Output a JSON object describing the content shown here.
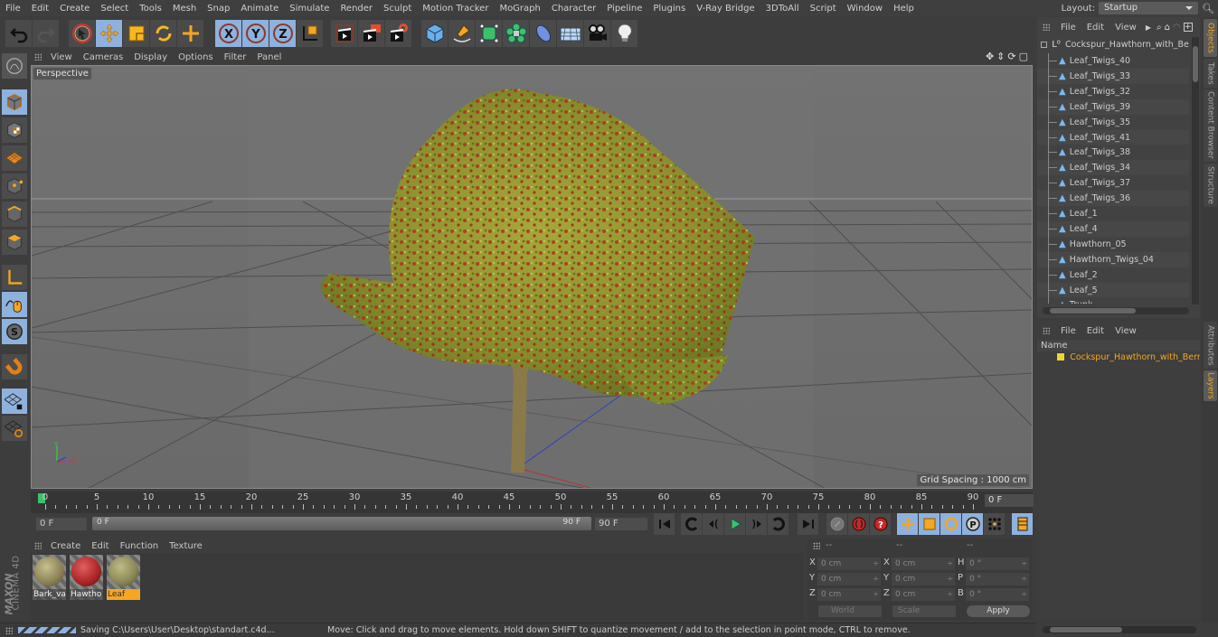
{
  "menubar": {
    "items": [
      "File",
      "Edit",
      "Create",
      "Select",
      "Tools",
      "Mesh",
      "Snap",
      "Animate",
      "Simulate",
      "Render",
      "Sculpt",
      "Motion Tracker",
      "MoGraph",
      "Character",
      "Pipeline",
      "Plugins",
      "V-Ray Bridge",
      "3DToAll",
      "Script",
      "Window",
      "Help"
    ],
    "layout_label": "Layout:",
    "layout_value": "Startup"
  },
  "toolbar": {
    "groups": [
      [
        "undo-icon",
        "redo-icon"
      ],
      [
        "live-selection-icon",
        "move-icon",
        "scale-icon",
        "rotate-icon",
        "recent-tool-icon"
      ],
      [
        "x-axis-lock-icon",
        "y-axis-lock-icon",
        "z-axis-lock-icon",
        "coordinate-system-icon"
      ],
      [
        "render-view-icon",
        "render-to-picture-viewer-icon",
        "render-settings-icon"
      ],
      [
        "cube-icon",
        "pen-spline-icon",
        "subdivision-surface-icon",
        "cloner-icon",
        "deformer-icon",
        "floor-icon",
        "camera-icon",
        "light-icon"
      ]
    ]
  },
  "left_tools": [
    "make-editable-icon",
    "model-mode-icon",
    "texture-mode-icon",
    "workplane-mode-icon",
    "points-mode-icon",
    "edges-mode-icon",
    "polygons-mode-icon",
    "axis-mode-icon",
    "tweak-mode-icon",
    "solo-icon",
    "snap-icon",
    "workplane-lock-icon",
    "workplane-align-icon"
  ],
  "viewport": {
    "menu": [
      "View",
      "Cameras",
      "Display",
      "Options",
      "Filter",
      "Panel"
    ],
    "label": "Perspective",
    "grid_spacing": "Grid Spacing : 1000 cm",
    "axis_labels": {
      "y": "Y",
      "z": "Z",
      "x": "X"
    }
  },
  "timeline": {
    "ticks": [
      "0",
      "5",
      "10",
      "15",
      "20",
      "25",
      "30",
      "35",
      "40",
      "45",
      "50",
      "55",
      "60",
      "65",
      "70",
      "75",
      "80",
      "85",
      "90"
    ],
    "current_frame": "0 F",
    "current_frame_field": "0 F"
  },
  "playback": {
    "start_field": "0 F",
    "range_start": "0 F",
    "range_end": "90 F",
    "end_field": "90 F",
    "buttons": [
      "go-to-start-icon",
      "previous-key-icon",
      "previous-frame-icon",
      "play-icon",
      "next-frame-icon",
      "next-key-icon",
      "go-to-end-icon"
    ],
    "record_buttons": [
      "motion-record-icon",
      "record-active-objects-icon",
      "autokeying-icon"
    ],
    "key_buttons": [
      "record-position-icon",
      "record-scale-icon",
      "record-rotation-icon",
      "record-parameter-icon",
      "record-point-level-icon"
    ],
    "timeline_button": "timeline-window-icon"
  },
  "materials": {
    "menu": [
      "Create",
      "Edit",
      "Function",
      "Texture"
    ],
    "items": [
      {
        "name": "Bark_var",
        "color": "#a39a6a",
        "selected": false
      },
      {
        "name": "Hawtho",
        "color": "#b0282a",
        "selected": false
      },
      {
        "name": "Leaf",
        "color": "#9a9560",
        "selected": true
      }
    ]
  },
  "brand": {
    "line1": "MAXON",
    "line2": "CINEMA 4D"
  },
  "coords": {
    "headers": [
      "--",
      "--",
      "--"
    ],
    "rows": [
      {
        "l1": "X",
        "v1": "0 cm",
        "l2": "X",
        "v2": "0 cm",
        "l3": "H",
        "v3": "0 °"
      },
      {
        "l1": "Y",
        "v1": "0 cm",
        "l2": "Y",
        "v2": "0 cm",
        "l3": "P",
        "v3": "0 °"
      },
      {
        "l1": "Z",
        "v1": "0 cm",
        "l2": "Z",
        "v2": "0 cm",
        "l3": "B",
        "v3": "0 °"
      }
    ],
    "mode_select": "World",
    "size_select": "Scale",
    "apply": "Apply"
  },
  "statusbar": {
    "progress": 1.0,
    "saving": "Saving C:\\Users\\User\\Desktop\\standart.c4d...",
    "hint": "Move: Click and drag to move elements. Hold down SHIFT to quantize movement / add to the selection in point mode, CTRL to remove."
  },
  "objects": {
    "menu": [
      "File",
      "Edit",
      "View"
    ],
    "root": "Cockspur_Hawthorn_with_Berries",
    "children": [
      "Leaf_Twigs_40",
      "Leaf_Twigs_33",
      "Leaf_Twigs_32",
      "Leaf_Twigs_39",
      "Leaf_Twigs_35",
      "Leaf_Twigs_41",
      "Leaf_Twigs_38",
      "Leaf_Twigs_34",
      "Leaf_Twigs_37",
      "Leaf_Twigs_36",
      "Leaf_1",
      "Leaf_4",
      "Hawthorn_05",
      "Hawthorn_Twigs_04",
      "Leaf_2",
      "Leaf_5",
      "Trunk"
    ]
  },
  "layers": {
    "menu": [
      "File",
      "Edit",
      "View"
    ],
    "column": "Name",
    "items": [
      {
        "name": "Cockspur_Hawthorn_with_Berries",
        "color": "#e8d830"
      }
    ]
  },
  "side_tabs": {
    "top": [
      {
        "label": "Objects",
        "active": true
      },
      {
        "label": "Takes",
        "active": false
      },
      {
        "label": "Content Browser",
        "active": false
      },
      {
        "label": "Structure",
        "active": false
      }
    ],
    "bottom": [
      {
        "label": "Attributes",
        "active": false
      },
      {
        "label": "Layers",
        "active": true
      }
    ]
  },
  "colors": {
    "accent": "#f5a623",
    "active_tool": "#8fb1dd",
    "panel": "#3d3d3d",
    "viewport": "#6e6e6e"
  }
}
